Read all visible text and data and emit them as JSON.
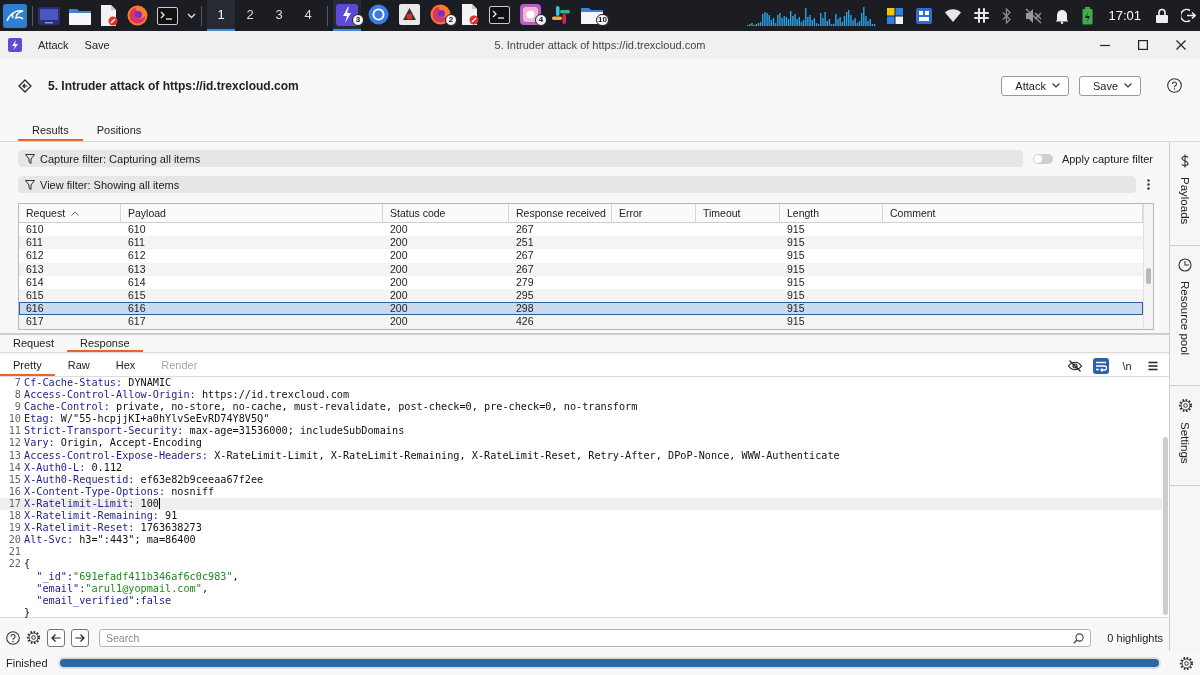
{
  "taskbar": {
    "launchers": [
      {
        "kind": "desktop"
      },
      {
        "kind": "folder"
      },
      {
        "kind": "document"
      },
      {
        "kind": "globe"
      },
      {
        "kind": "terminal"
      }
    ],
    "workspaces": [
      {
        "label": "1",
        "selected": true
      },
      {
        "label": "2",
        "selected": false
      },
      {
        "label": "3",
        "selected": false
      },
      {
        "label": "4",
        "selected": false
      }
    ],
    "tasks": [
      {
        "kind": "bolt",
        "badge": "3",
        "selected": true
      },
      {
        "kind": "ring",
        "selected": false
      },
      {
        "kind": "app",
        "selected": false
      },
      {
        "kind": "globe",
        "badge": "2",
        "selected": false
      },
      {
        "kind": "document",
        "selected": false
      },
      {
        "kind": "terminal",
        "selected": false
      },
      {
        "kind": "image",
        "badge": "4",
        "selected": false
      },
      {
        "kind": "hash",
        "selected": false
      },
      {
        "kind": "folder",
        "badge": "10",
        "selected": false
      }
    ],
    "clock": "17:01"
  },
  "window": {
    "menu": [
      "Attack",
      "Save"
    ],
    "title": "5. Intruder attack of https://id.trexcloud.com"
  },
  "header": {
    "title": "5. Intruder attack of https://id.trexcloud.com",
    "buttons": [
      "Attack",
      "Save"
    ]
  },
  "tabs": [
    {
      "label": "Results",
      "selected": true
    },
    {
      "label": "Positions",
      "selected": false
    }
  ],
  "filters": {
    "capture_filter": "Capture filter: Capturing all items",
    "apply_capture_filter": {
      "label": "Apply capture filter",
      "on": false
    },
    "view_filter": "View filter: Showing all items"
  },
  "table": {
    "columns": [
      {
        "label": "Request",
        "sorted": true
      },
      {
        "label": "Payload",
        "sorted": false
      },
      {
        "label": "Status code",
        "sorted": false
      },
      {
        "label": "Response received",
        "sorted": false
      },
      {
        "label": "Error",
        "sorted": false
      },
      {
        "label": "Timeout",
        "sorted": false
      },
      {
        "label": "Length",
        "sorted": false
      },
      {
        "label": "Comment",
        "sorted": false
      }
    ],
    "rows": [
      {
        "request": "610",
        "payload": "610",
        "status_code": "200",
        "response_received": "267",
        "length": "915",
        "selected": false
      },
      {
        "request": "611",
        "payload": "611",
        "status_code": "200",
        "response_received": "251",
        "length": "915",
        "selected": false
      },
      {
        "request": "612",
        "payload": "612",
        "status_code": "200",
        "response_received": "267",
        "length": "915",
        "selected": false
      },
      {
        "request": "613",
        "payload": "613",
        "status_code": "200",
        "response_received": "267",
        "length": "915",
        "selected": false
      },
      {
        "request": "614",
        "payload": "614",
        "status_code": "200",
        "response_received": "279",
        "length": "915",
        "selected": false
      },
      {
        "request": "615",
        "payload": "615",
        "status_code": "200",
        "response_received": "295",
        "length": "915",
        "selected": false
      },
      {
        "request": "616",
        "payload": "616",
        "status_code": "200",
        "response_received": "298",
        "length": "915",
        "selected": true
      },
      {
        "request": "617",
        "payload": "617",
        "status_code": "200",
        "response_received": "426",
        "length": "915",
        "selected": false
      }
    ]
  },
  "message_tabs": [
    {
      "label": "Request",
      "selected": false
    },
    {
      "label": "Response",
      "selected": true
    }
  ],
  "view_tabs": [
    {
      "label": "Pretty",
      "selected": true,
      "disabled": false
    },
    {
      "label": "Raw",
      "selected": false,
      "disabled": false
    },
    {
      "label": "Hex",
      "selected": false,
      "disabled": false
    },
    {
      "label": "Render",
      "selected": false,
      "disabled": true
    }
  ],
  "editor_tools": [
    {
      "kind": "hide",
      "on": false
    },
    {
      "kind": "wrap",
      "on": true
    },
    {
      "kind": "newline",
      "label": "\\n",
      "on": false
    },
    {
      "kind": "menu",
      "on": false
    }
  ],
  "response": {
    "lines": [
      {
        "number": "7",
        "current": false,
        "tokens": [
          {
            "kind": "name",
            "text": "Cf-Cache-Status:"
          },
          {
            "kind": "text",
            "text": " DYNAMIC"
          }
        ]
      },
      {
        "number": "8",
        "current": false,
        "tokens": [
          {
            "kind": "name",
            "text": "Access-Control-Allow-Origin:"
          },
          {
            "kind": "text",
            "text": " https://id.trexcloud.com"
          }
        ]
      },
      {
        "number": "9",
        "current": false,
        "tokens": [
          {
            "kind": "name",
            "text": "Cache-Control:"
          },
          {
            "kind": "text",
            "text": " private, no-store, no-cache, must-revalidate, post-check=0, pre-check=0, no-transform"
          }
        ]
      },
      {
        "number": "10",
        "current": false,
        "tokens": [
          {
            "kind": "name",
            "text": "Etag:"
          },
          {
            "kind": "text",
            "text": " W/\"55-hcpjjKI+a0hYlvSeEvRD74Y8V5Q\""
          }
        ]
      },
      {
        "number": "11",
        "current": false,
        "tokens": [
          {
            "kind": "name",
            "text": "Strict-Transport-Security:"
          },
          {
            "kind": "text",
            "text": " max-age=31536000; includeSubDomains"
          }
        ]
      },
      {
        "number": "12",
        "current": false,
        "tokens": [
          {
            "kind": "name",
            "text": "Vary:"
          },
          {
            "kind": "text",
            "text": " Origin, Accept-Encoding"
          }
        ]
      },
      {
        "number": "13",
        "current": false,
        "tokens": [
          {
            "kind": "name",
            "text": "Access-Control-Expose-Headers:"
          },
          {
            "kind": "text",
            "text": " X-RateLimit-Limit, X-RateLimit-Remaining, X-RateLimit-Reset, Retry-After, DPoP-Nonce, WWW-Authenticate"
          }
        ]
      },
      {
        "number": "14",
        "current": false,
        "tokens": [
          {
            "kind": "name",
            "text": "X-Auth0-L:"
          },
          {
            "kind": "text",
            "text": " 0.112"
          }
        ]
      },
      {
        "number": "15",
        "current": false,
        "tokens": [
          {
            "kind": "name",
            "text": "X-Auth0-Requestid:"
          },
          {
            "kind": "text",
            "text": " ef63e82b9ceeaa67f2ee"
          }
        ]
      },
      {
        "number": "16",
        "current": false,
        "tokens": [
          {
            "kind": "name",
            "text": "X-Content-Type-Options:"
          },
          {
            "kind": "text",
            "text": " nosniff"
          }
        ]
      },
      {
        "number": "17",
        "current": true,
        "tokens": [
          {
            "kind": "name",
            "text": "X-Ratelimit-Limit:"
          },
          {
            "kind": "text",
            "text": " 100"
          }
        ]
      },
      {
        "number": "18",
        "current": false,
        "tokens": [
          {
            "kind": "name",
            "text": "X-Ratelimit-Remaining:"
          },
          {
            "kind": "text",
            "text": " 91"
          }
        ]
      },
      {
        "number": "19",
        "current": false,
        "tokens": [
          {
            "kind": "name",
            "text": "X-Ratelimit-Reset:"
          },
          {
            "kind": "text",
            "text": " 1763638273"
          }
        ]
      },
      {
        "number": "20",
        "current": false,
        "tokens": [
          {
            "kind": "name",
            "text": "Alt-Svc:"
          },
          {
            "kind": "text",
            "text": " h3=\":443\"; ma=86400"
          }
        ]
      },
      {
        "number": "21",
        "current": false
      },
      {
        "number": "22",
        "current": false,
        "tokens": [
          {
            "kind": "text",
            "text": "{"
          }
        ]
      },
      {
        "current": false,
        "tokens": [
          {
            "kind": "name",
            "text": "  \"_id\""
          },
          {
            "kind": "text",
            "text": ":"
          },
          {
            "kind": "string",
            "text": "\"691efadf411b346af6c0c983\""
          },
          {
            "kind": "text",
            "text": ","
          }
        ]
      },
      {
        "current": false,
        "tokens": [
          {
            "kind": "name",
            "text": "  \"email\""
          },
          {
            "kind": "text",
            "text": ":"
          },
          {
            "kind": "string",
            "text": "\"arul1@yopmail.com\""
          },
          {
            "kind": "text",
            "text": ","
          }
        ]
      },
      {
        "current": false,
        "tokens": [
          {
            "kind": "name",
            "text": "  \"email_verified\""
          },
          {
            "kind": "text",
            "text": ":"
          },
          {
            "kind": "keyword",
            "text": "false"
          }
        ]
      },
      {
        "current": false,
        "tokens": [
          {
            "kind": "text",
            "text": "}"
          }
        ]
      }
    ]
  },
  "search": {
    "placeholder": "Search",
    "highlights": "0 highlights"
  },
  "status_bar": {
    "text": "Finished",
    "level": 1
  },
  "side_panels": [
    {
      "kind": "payloads",
      "label": "Payloads"
    },
    {
      "kind": "pool",
      "label": "Resource pool"
    },
    {
      "kind": "settings",
      "label": "Settings"
    }
  ]
}
